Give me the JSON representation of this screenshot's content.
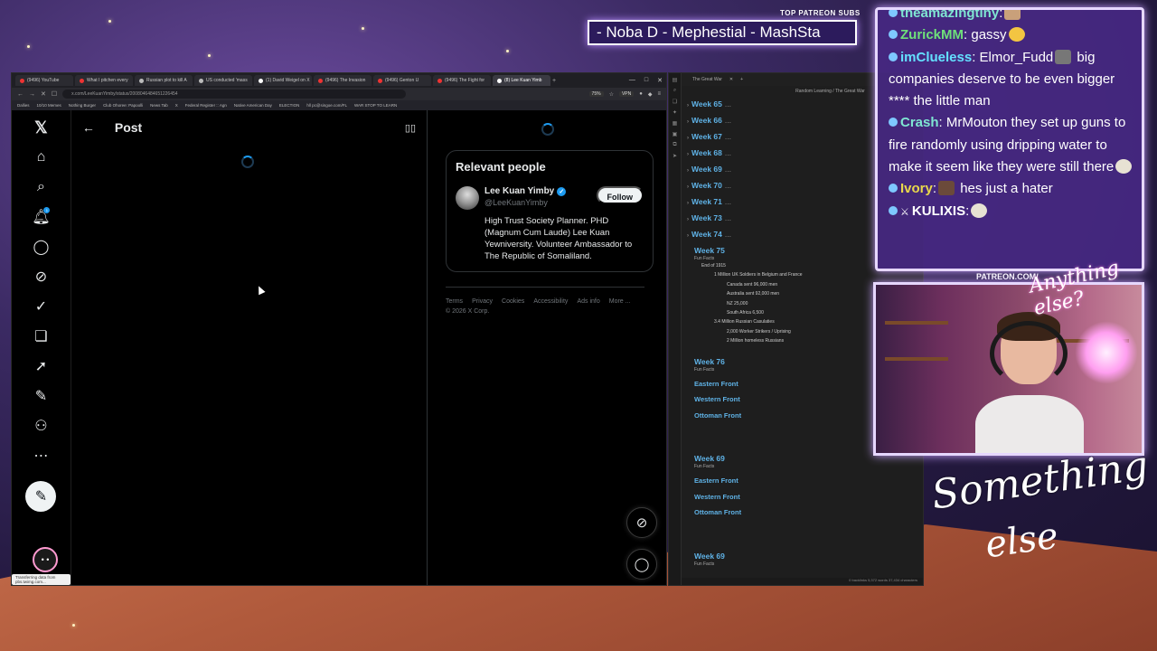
{
  "overlay": {
    "patreon_label": "TOP PATREON SUBS",
    "patreon_names": "-  Noba D - Mephestial - MashSta",
    "cam_label": "PATREON.COM/",
    "cam_brand": "Anything else?",
    "signature_line1": "Something",
    "signature_line2": "else"
  },
  "chat": [
    {
      "user": "theamazingtiny",
      "text": ":",
      "user_color": "u-teal"
    },
    {
      "user": "ZurickMM",
      "text": ": gassy",
      "user_color": "u-green"
    },
    {
      "user": "imClueless",
      "text": ": Elmor_Fudd",
      "extra": " big companies deserve to be even bigger **** the little man",
      "user_color": "u-cyan"
    },
    {
      "user": "Crash",
      "text": ": MrMouton they set up guns to fire randomly using dripping water to make it seem like they were still there",
      "user_color": "u-teal"
    },
    {
      "user": "Ivory",
      "text": ":",
      "extra": " hes just a hater",
      "user_color": "u-yellow"
    },
    {
      "user": "KULIXIS",
      "text": ":",
      "user_color": "u-white"
    }
  ],
  "browser": {
    "tabs": [
      {
        "label": "(9496) YouTube"
      },
      {
        "label": "What I pitchen every"
      },
      {
        "label": "Russian plot to kill A"
      },
      {
        "label": "US conducted 'mass"
      },
      {
        "label": "(1) David Weigel on X"
      },
      {
        "label": "(9496) The Invasion"
      },
      {
        "label": "(9496) Genton U"
      },
      {
        "label": "(9496) The Fight for"
      },
      {
        "label": "(8) Lee Kuan Yimb"
      }
    ],
    "url": "x.com/LeeKuanYimby/status/2008046484651226454",
    "zoom": "75%",
    "vpn": "VPN",
    "bookmarks": [
      "Dallies",
      "10/10 Memes",
      "Nothing Burger",
      "Club Ohoree: Papoolli",
      "News Tab",
      "X",
      "Federal Register :: Agn",
      "Native American Day",
      "ELECTION",
      "hll pc@singoe.com/FL",
      "WAR STOP TO LEARN"
    ],
    "status_text": "Transferring data from pbs.twimg.com..."
  },
  "x": {
    "post_title": "Post",
    "notif_count": "1",
    "relevant_title": "Relevant people",
    "person_name": "Lee Kuan Yimby",
    "person_handle": "@LeeKuanYimby",
    "person_bio": "High Trust Society Planner. PHD (Magnum Cum Laude) Lee Kuan Yewniversity. Volunteer Ambassador to The Republic of Somaliland.",
    "follow_label": "Follow",
    "footer": [
      "Terms",
      "Privacy",
      "Cookies",
      "Accessibility",
      "Ads info",
      "More ...",
      "© 2026 X Corp."
    ],
    "avatar_face": "• •"
  },
  "notes": {
    "tab_title": "The Great War",
    "breadcrumb": "Random Learning  /  The Great War",
    "weeks_top": [
      "Week 65",
      "Week 66",
      "Week 67",
      "Week 68",
      "Week 69",
      "Week 70",
      "Week 71",
      "Week 73",
      "Week 74"
    ],
    "week75": "Week 75",
    "fun_facts": "Fun Facts",
    "lines": [
      "End of 1915",
      "1 Million UK Soldiers in Belgium and France",
      "Canada sent 96,000 men",
      "Australia sent 92,000 men",
      "NZ 25,000",
      "South Africa 6,500",
      "3.4 Million Russian Casulaties",
      "2,000 Worker Strikers / Uprising",
      "2 Million homeless Russians"
    ],
    "week76": "Week 76",
    "sections": [
      "Eastern Front",
      "Western Front",
      "Ottoman Front"
    ],
    "week69b": "Week 69",
    "week69c": "Week 69",
    "status": "0 backlinks   5,372 words   37,434 characters"
  }
}
